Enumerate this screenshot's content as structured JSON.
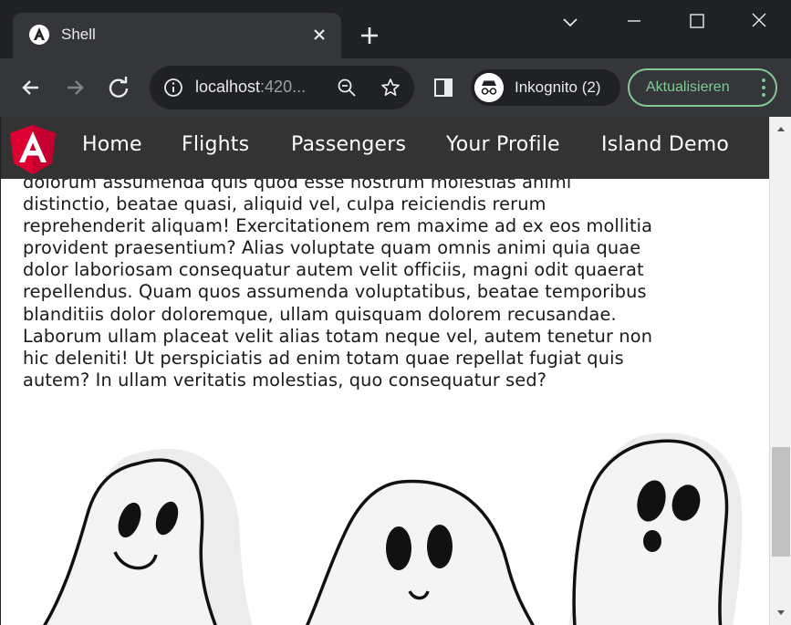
{
  "browser": {
    "tab_title": "Shell",
    "url_host": "localhost",
    "url_rest": ":420...",
    "profile_label": "Inkognito (2)",
    "update_label": "Aktualisieren"
  },
  "app": {
    "nav": [
      {
        "label": "Home"
      },
      {
        "label": "Flights"
      },
      {
        "label": "Passengers"
      },
      {
        "label": "Your Profile"
      },
      {
        "label": "Island Demo"
      }
    ],
    "lines": [
      "dolorum assumenda quis quod esse nostrum molestias animi",
      "distinctio, beatae quasi, aliquid vel, culpa reiciendis rerum",
      "reprehenderit aliquam! Exercitationem rem maxime ad ex eos mollitia",
      "provident praesentium? Alias voluptate quam omnis animi quia quae",
      "dolor laboriosam consequatur autem velit officiis, magni odit quaerat",
      "repellendus. Quam quos assumenda voluptatibus, beatae temporibus",
      "blanditiis dolor doloremque, ullam quisquam dolorem recusandae.",
      "Laborum ullam placeat velit alias totam neque vel, autem tenetur non",
      "hic deleniti! Ut perspiciatis ad enim totam quae repellat fugiat quis",
      "autem? In ullam veritatis molestias, quo consequatur sed?"
    ]
  },
  "colors": {
    "accent_green": "#81c995",
    "angular_red": "#dd0031",
    "navbar_bg": "#333333"
  },
  "icons": [
    "angular-favicon-icon",
    "close-icon",
    "plus-icon",
    "chevron-down-icon",
    "minimize-icon",
    "maximize-icon",
    "window-close-icon",
    "back-arrow-icon",
    "forward-arrow-icon",
    "reload-icon",
    "info-icon",
    "zoom-icon",
    "star-icon",
    "side-panel-icon",
    "incognito-icon",
    "kebab-menu-icon",
    "angular-logo-icon"
  ]
}
